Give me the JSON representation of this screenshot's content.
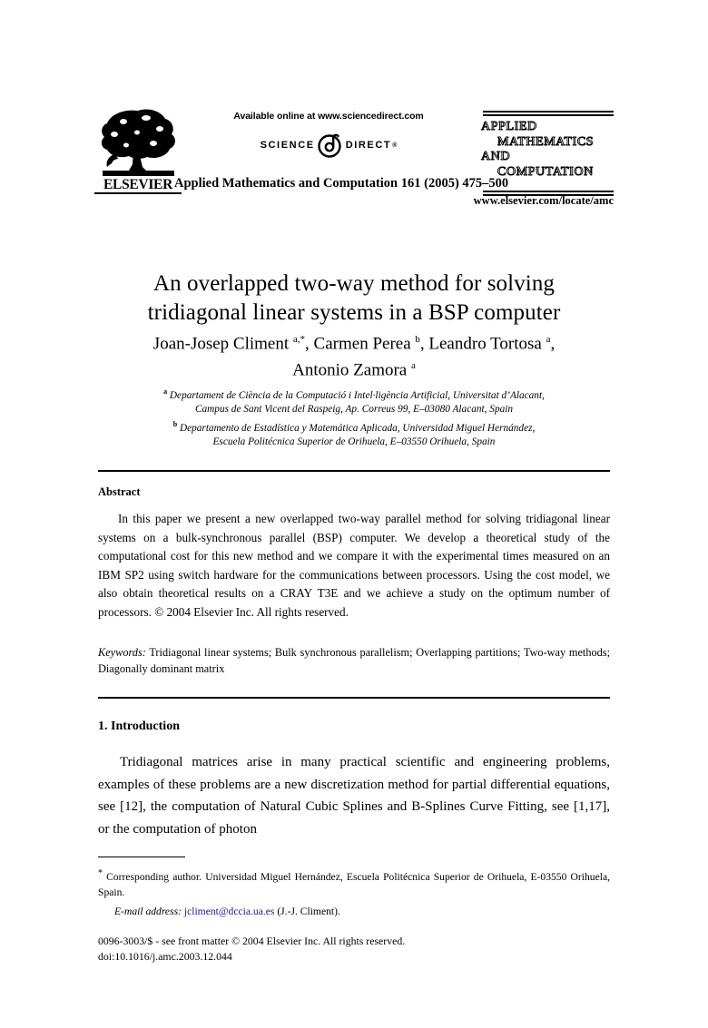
{
  "masthead": {
    "publisher_name": "ELSEVIER",
    "publisher_logo_icon": "elsevier-tree-logo",
    "available_online": "Available online at www.sciencedirect.com",
    "sciencedirect_science": "SCIENCE",
    "sciencedirect_at_icon": "at-sign-icon",
    "sciencedirect_direct": "DIRECT",
    "sciencedirect_registered": "®",
    "journal_mark_line1": "APPLIED",
    "journal_mark_line2": "MATHEMATICS",
    "journal_mark_line3": "AND",
    "journal_mark_line4": "COMPUTATION",
    "journal_citation": "Applied Mathematics and Computation 161 (2005) 475–500",
    "journal_url": "www.elsevier.com/locate/amc"
  },
  "article": {
    "title_line1": "An overlapped two-way method for solving",
    "title_line2": "tridiagonal linear systems in a BSP computer",
    "authors_line1_a": "Joan-Josep Climent ",
    "authors_line1_sup1": "a,*",
    "authors_line1_b": ", Carmen Perea ",
    "authors_line1_sup2": "b",
    "authors_line1_c": ", Leandro Tortosa ",
    "authors_line1_sup3": "a",
    "authors_line1_d": ",",
    "authors_line2_a": "Antonio Zamora ",
    "authors_line2_sup": "a",
    "affiliation_a_sup": "a",
    "affiliation_a_line1": " Departament de Ciència de la Computació i Intel·ligència Artificial, Universitat d’Alacant,",
    "affiliation_a_line2": "Campus de Sant Vicent del Raspeig, Ap. Correus 99, E–03080 Alacant, Spain",
    "affiliation_b_sup": "b",
    "affiliation_b_line1": " Departamento de Estadística y Matemática Aplicada, Universidad Miguel Hernández,",
    "affiliation_b_line2": "Escuela Politécnica Superior de Orihuela, E–03550 Orihuela, Spain"
  },
  "abstract": {
    "heading": "Abstract",
    "text": "In this paper we present a new overlapped two-way parallel method for solving tridiagonal linear systems on a bulk-synchronous parallel (BSP) computer. We develop a theoretical study of the computational cost for this new method and we compare it with the experimental times measured on an IBM SP2 using switch hardware for the communications between processors. Using the cost model, we also obtain theoretical results on a CRAY T3E and we achieve a study on the optimum number of processors. © 2004 Elsevier Inc. All rights reserved."
  },
  "keywords": {
    "label": "Keywords:",
    "text": " Tridiagonal linear systems; Bulk synchronous parallelism; Overlapping partitions; Two-way methods; Diagonally dominant matrix"
  },
  "section1": {
    "heading": "1. Introduction",
    "paragraph": "Tridiagonal matrices arise in many practical scientific and engineering problems, examples of these problems are a new discretization method for partial differential equations, see [12], the computation of Natural Cubic Splines and B-Splines Curve Fitting, see [1,17], or the computation of photon"
  },
  "footnotes": {
    "star": "*",
    "corresponding_author": " Corresponding author. Universidad Miguel Hernández, Escuela Politécnica Superior de Orihuela, E-03550 Orihuela, Spain.",
    "email_label": "E-mail address:",
    "email_address": "jcliment@dccia.ua.es",
    "email_owner": "(J.-J. Climent).",
    "email_link_color": "#1a1a8c"
  },
  "imprint": {
    "issn_line": "0096-3003/$ - see front matter © 2004 Elsevier Inc. All rights reserved.",
    "doi_line": "doi:10.1016/j.amc.2003.12.044"
  }
}
